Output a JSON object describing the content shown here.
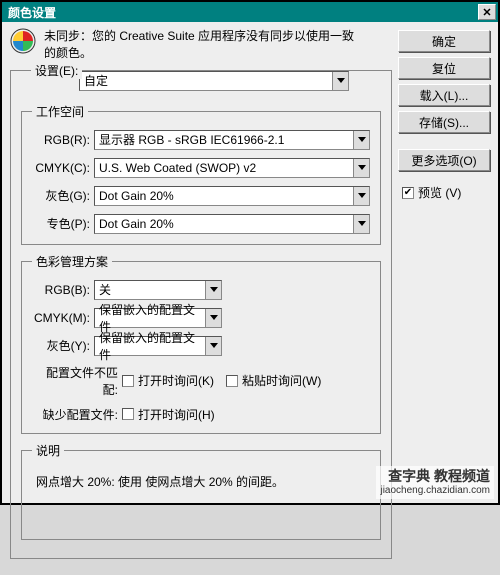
{
  "window": {
    "title": "颜色设置",
    "close_glyph": "✕"
  },
  "sync": {
    "line1": "未同步：您的 Creative Suite 应用程序没有同步以使用一致",
    "line2": "的颜色。"
  },
  "buttons": {
    "ok": "确定",
    "reset": "复位",
    "load": "载入(L)...",
    "save": "存储(S)...",
    "more": "更多选项(O)"
  },
  "preview": {
    "label": "预览 (V)",
    "checked": true
  },
  "settings": {
    "label": "设置(E):",
    "value": "自定"
  },
  "workspace": {
    "legend": "工作空间",
    "rgb_label": "RGB(R):",
    "rgb_value": "显示器 RGB - sRGB IEC61966-2.1",
    "cmyk_label": "CMYK(C):",
    "cmyk_value": "U.S. Web Coated (SWOP) v2",
    "gray_label": "灰色(G):",
    "gray_value": "Dot Gain 20%",
    "spot_label": "专色(P):",
    "spot_value": "Dot Gain 20%"
  },
  "policy": {
    "legend": "色彩管理方案",
    "rgb_label": "RGB(B):",
    "rgb_value": "关",
    "cmyk_label": "CMYK(M):",
    "cmyk_value": "保留嵌入的配置文件",
    "gray_label": "灰色(Y):",
    "gray_value": "保留嵌入的配置文件",
    "mismatch_label": "配置文件不匹配:",
    "mismatch_open": "打开时询问(K)",
    "mismatch_paste": "粘贴时询问(W)",
    "missing_label": "缺少配置文件:",
    "missing_open": "打开时询问(H)"
  },
  "description": {
    "legend": "说明",
    "text": "网点增大 20%: 使用 使网点增大 20% 的间距。"
  },
  "watermark": {
    "line1": "查字典 教程频道",
    "line2": "jiaocheng.chazidian.com"
  }
}
